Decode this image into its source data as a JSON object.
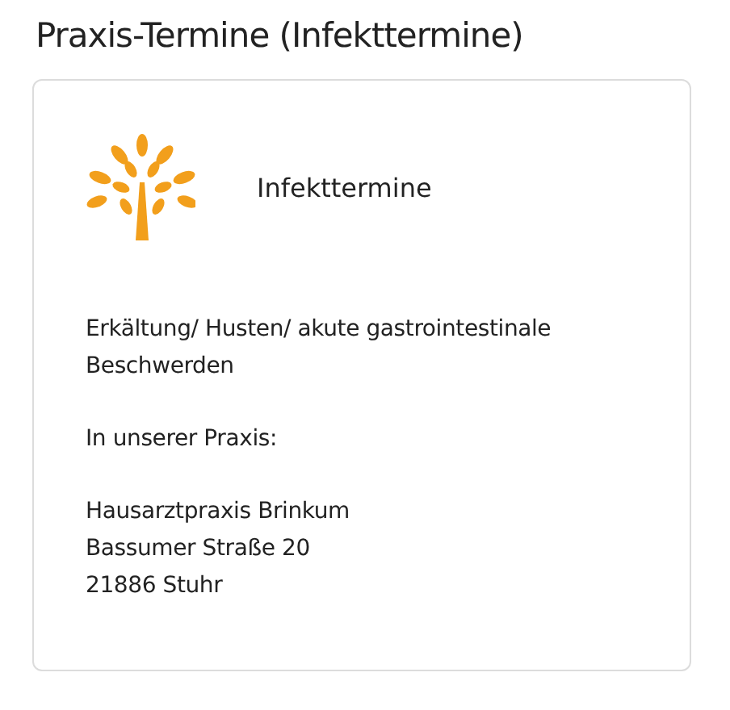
{
  "page_title": "Praxis-Termine (Infekttermine)",
  "card": {
    "title": "Infekttermine",
    "paragraphs": [
      {
        "lines": [
          "Erkältung/ Husten/ akute gastrointestinale Beschwerden"
        ]
      },
      {
        "lines": [
          "In unserer Praxis:"
        ]
      },
      {
        "lines": [
          "Hausarztpraxis Brinkum",
          "Bassumer Straße 20",
          "21886 Stuhr"
        ]
      }
    ]
  }
}
